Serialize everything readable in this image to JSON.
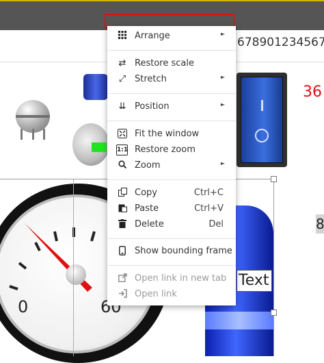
{
  "canvas": {
    "number_string": "678901234567",
    "red_value": "36",
    "right_digit": "8",
    "text_widget": "Text",
    "gauge_labels": [
      "0",
      "60"
    ]
  },
  "context_menu": {
    "groups": [
      [
        {
          "label": "Arrange",
          "icon": "grid-icon",
          "submenu": true
        }
      ],
      [
        {
          "label": "Restore scale",
          "icon": "restore-scale-icon"
        },
        {
          "label": "Stretch",
          "icon": "stretch-icon",
          "submenu": true
        }
      ],
      [
        {
          "label": "Position",
          "icon": "position-icon",
          "submenu": true
        }
      ],
      [
        {
          "label": "Fit the window",
          "icon": "fit-window-icon"
        },
        {
          "label": "Restore zoom",
          "icon": "one-to-one-icon"
        },
        {
          "label": "Zoom",
          "icon": "zoom-icon",
          "submenu": true
        }
      ],
      [
        {
          "label": "Copy",
          "icon": "copy-icon",
          "shortcut": "Ctrl+C"
        },
        {
          "label": "Paste",
          "icon": "paste-icon",
          "shortcut": "Ctrl+V"
        },
        {
          "label": "Delete",
          "icon": "trash-icon",
          "shortcut": "Del"
        }
      ],
      [
        {
          "label": "Show bounding frame",
          "icon": "mobile-icon"
        }
      ],
      [
        {
          "label": "Open link in new tab",
          "icon": "external-link-icon",
          "disabled": true
        },
        {
          "label": "Open link",
          "icon": "sign-in-icon",
          "disabled": true
        }
      ]
    ]
  },
  "colors": {
    "highlight": "#e01010",
    "toolbar": "#555555",
    "switch": "#2a56c6",
    "tank": "#1f3fe0"
  }
}
